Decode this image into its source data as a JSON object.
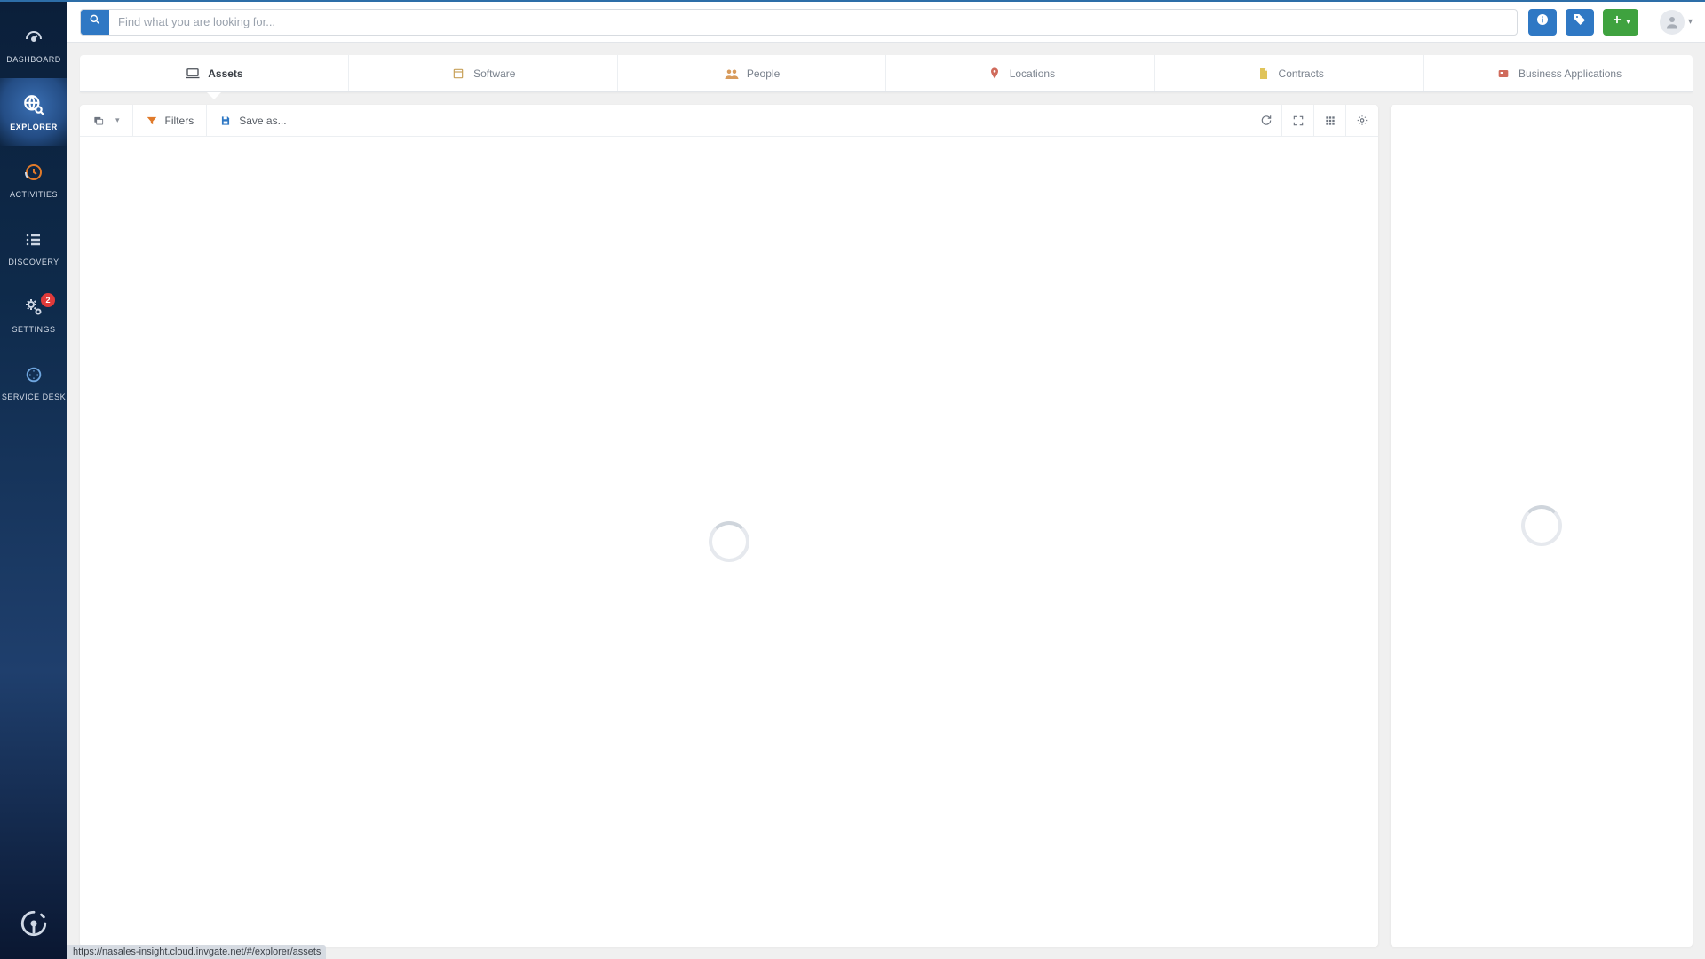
{
  "search": {
    "placeholder": "Find what you are looking for..."
  },
  "sidebar": {
    "items": [
      {
        "label": "DASHBOARD"
      },
      {
        "label": "EXPLORER"
      },
      {
        "label": "ACTIVITIES"
      },
      {
        "label": "DISCOVERY"
      },
      {
        "label": "SETTINGS",
        "badge": "2"
      },
      {
        "label": "SERVICE DESK"
      }
    ]
  },
  "category_tabs": {
    "items": [
      {
        "label": "Assets"
      },
      {
        "label": "Software"
      },
      {
        "label": "People"
      },
      {
        "label": "Locations"
      },
      {
        "label": "Contracts"
      },
      {
        "label": "Business Applications"
      }
    ]
  },
  "toolbar": {
    "filters_label": "Filters",
    "save_as_label": "Save as..."
  },
  "status_link": "https://nasales-insight.cloud.invgate.net/#/explorer/assets",
  "colors": {
    "primary_blue": "#2f78c4",
    "green": "#3fa23f",
    "orange": "#e07a2a",
    "red_badge": "#e03a3a"
  }
}
